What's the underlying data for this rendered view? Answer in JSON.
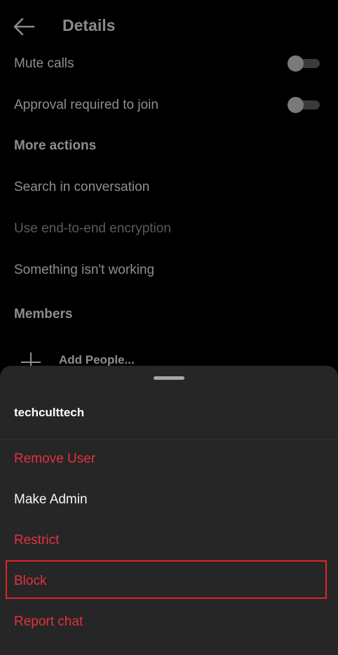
{
  "header": {
    "title": "Details",
    "back_icon": "arrow-left-icon"
  },
  "settings": {
    "mute_calls": {
      "label": "Mute calls",
      "on": false
    },
    "approval_required": {
      "label": "Approval required to join",
      "on": false
    },
    "more_actions_heading": "More actions",
    "search_in_conversation": "Search in conversation",
    "use_e2e_encryption": "Use end-to-end encryption",
    "something_isnt_working": "Something isn't working",
    "members_heading": "Members",
    "add_people": "Add People..."
  },
  "sheet": {
    "username": "techculttech",
    "options": {
      "remove_user": "Remove User",
      "make_admin": "Make Admin",
      "restrict": "Restrict",
      "block": "Block",
      "report_chat": "Report chat"
    }
  },
  "colors": {
    "background": "#000000",
    "sheet_background": "#262626",
    "destructive": "#e0323e",
    "highlight_border": "#e0232b",
    "muted_text": "#8e8e8e"
  }
}
